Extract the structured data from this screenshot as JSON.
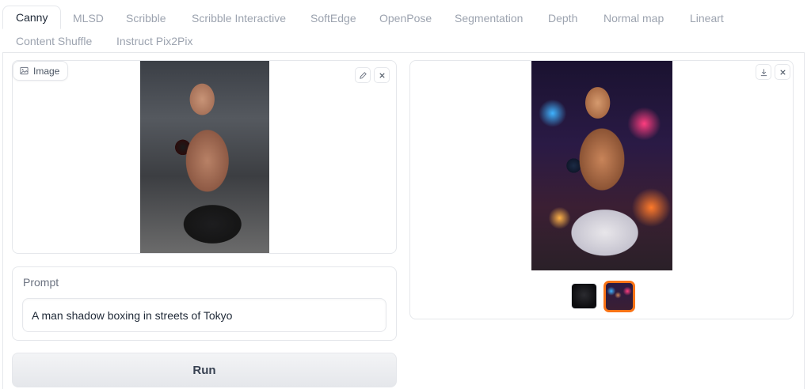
{
  "tabs": [
    {
      "label": "Canny"
    },
    {
      "label": "MLSD"
    },
    {
      "label": "Scribble"
    },
    {
      "label": "Scribble Interactive"
    },
    {
      "label": "SoftEdge"
    },
    {
      "label": "OpenPose"
    },
    {
      "label": "Segmentation"
    },
    {
      "label": "Depth"
    },
    {
      "label": "Normal map"
    },
    {
      "label": "Lineart"
    },
    {
      "label": "Content Shuffle"
    },
    {
      "label": "Instruct Pix2Pix"
    }
  ],
  "input_panel": {
    "label": "Image",
    "icons": [
      "image-icon",
      "edit-icon",
      "close-icon"
    ]
  },
  "output_panel": {
    "icons": [
      "download-icon",
      "close-icon"
    ],
    "selected_thumbnail": 2
  },
  "prompt": {
    "label": "Prompt",
    "value": "A man shadow boxing in streets of Tokyo"
  },
  "run": {
    "label": "Run"
  },
  "colors": {
    "accent": "#f97316",
    "border": "#e5e7eb",
    "inactive_tab": "#9ca3af"
  }
}
